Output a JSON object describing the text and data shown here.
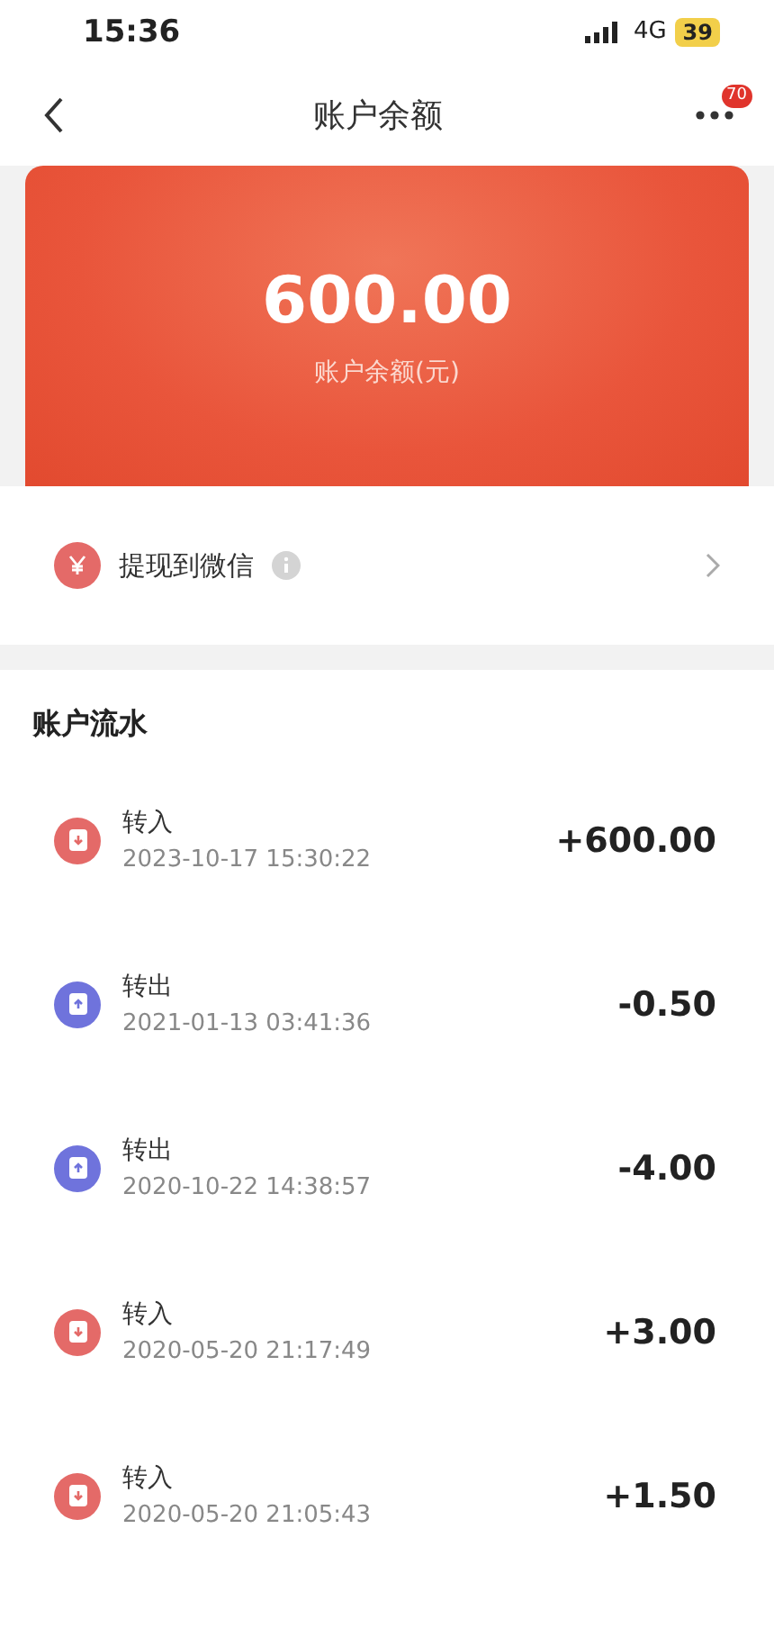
{
  "status_bar": {
    "time": "15:36",
    "network": "4G",
    "battery": "39"
  },
  "nav": {
    "title": "账户余额",
    "badge": "70"
  },
  "balance": {
    "amount": "600.00",
    "label": "账户余额(元)"
  },
  "withdraw": {
    "label": "提现到微信"
  },
  "ledger": {
    "title": "账户流水",
    "rows": [
      {
        "kind": "in",
        "type": "转入",
        "time": "2023-10-17 15:30:22",
        "amount": "+600.00"
      },
      {
        "kind": "out",
        "type": "转出",
        "time": "2021-01-13 03:41:36",
        "amount": "-0.50"
      },
      {
        "kind": "out",
        "type": "转出",
        "time": "2020-10-22 14:38:57",
        "amount": "-4.00"
      },
      {
        "kind": "in",
        "type": "转入",
        "time": "2020-05-20 21:17:49",
        "amount": "+3.00"
      },
      {
        "kind": "in",
        "type": "转入",
        "time": "2020-05-20 21:05:43",
        "amount": "+1.50"
      }
    ]
  }
}
